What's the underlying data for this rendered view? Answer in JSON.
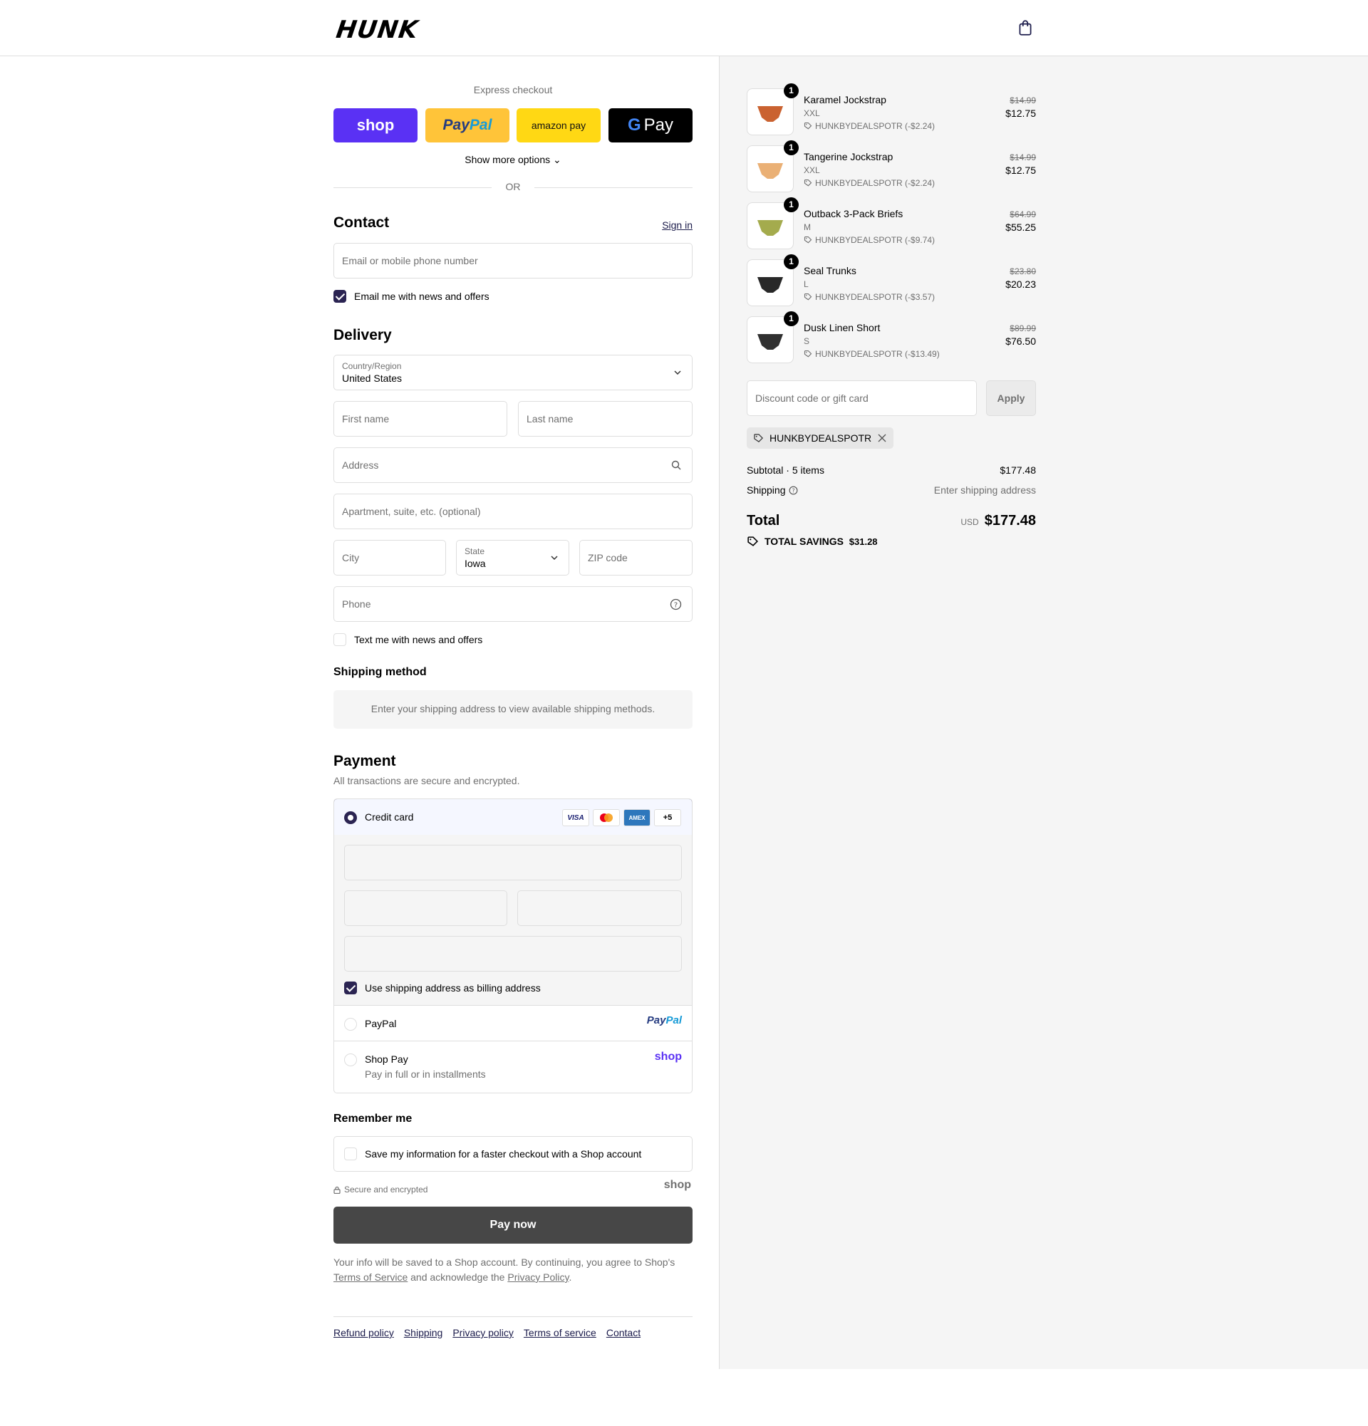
{
  "header": {
    "logo": "HUNK"
  },
  "express": {
    "title": "Express checkout",
    "shop": "shop",
    "paypal_a": "Pay",
    "paypal_b": "Pal",
    "amazon": "amazon pay",
    "gpay_g": "G",
    "gpay": "Pay",
    "more": "Show more options ⌄",
    "or": "OR"
  },
  "contact": {
    "heading": "Contact",
    "sign_in": "Sign in",
    "email_placeholder": "Email or mobile phone number",
    "news_label": "Email me with news and offers"
  },
  "delivery": {
    "heading": "Delivery",
    "country_label": "Country/Region",
    "country_value": "United States",
    "first_name": "First name",
    "last_name": "Last name",
    "address": "Address",
    "apartment": "Apartment, suite, etc. (optional)",
    "city": "City",
    "state_label": "State",
    "state_value": "Iowa",
    "zip": "ZIP code",
    "phone": "Phone",
    "text_label": "Text me with news and offers"
  },
  "shipping_method": {
    "heading": "Shipping method",
    "note": "Enter your shipping address to view available shipping methods."
  },
  "payment": {
    "heading": "Payment",
    "subtitle": "All transactions are secure and encrypted.",
    "credit_card": "Credit card",
    "visa": "VISA",
    "amex": "AMEX",
    "more_cards": "+5",
    "billing_label": "Use shipping address as billing address",
    "paypal": "PayPal",
    "paypal_logo_a": "Pay",
    "paypal_logo_b": "Pal",
    "shop_pay": "Shop Pay",
    "shop_pay_sub": "Pay in full or in installments",
    "shop_logo": "shop"
  },
  "remember": {
    "heading": "Remember me",
    "save_label": "Save my information for a faster checkout with a Shop account",
    "secure": "Secure and encrypted",
    "shop_logo": "shop"
  },
  "pay_now": "Pay now",
  "legal": {
    "line1": "Your info will be saved to a Shop account. By continuing, you agree to Shop's",
    "tos": "Terms of Service",
    "and": "and acknowledge the",
    "privacy": "Privacy Policy",
    "end": "."
  },
  "footer": [
    "Refund policy",
    "Shipping",
    "Privacy policy",
    "Terms of service",
    "Contact"
  ],
  "summary": {
    "items": [
      {
        "name": "Karamel Jockstrap",
        "variant": "XXL",
        "discount": "HUNKBYDEALSPOTR (-$2.24)",
        "old": "$14.99",
        "price": "$12.75",
        "qty": "1",
        "color": "#c4511a"
      },
      {
        "name": "Tangerine Jockstrap",
        "variant": "XXL",
        "discount": "HUNKBYDEALSPOTR (-$2.24)",
        "old": "$14.99",
        "price": "$12.75",
        "qty": "1",
        "color": "#e8a766"
      },
      {
        "name": "Outback 3-Pack Briefs",
        "variant": "M",
        "discount": "HUNKBYDEALSPOTR (-$9.74)",
        "old": "$64.99",
        "price": "$55.25",
        "qty": "1",
        "color": "#9aa23a"
      },
      {
        "name": "Seal Trunks",
        "variant": "L",
        "discount": "HUNKBYDEALSPOTR (-$3.57)",
        "old": "$23.80",
        "price": "$20.23",
        "qty": "1",
        "color": "#111111"
      },
      {
        "name": "Dusk Linen Short",
        "variant": "S",
        "discount": "HUNKBYDEALSPOTR (-$13.49)",
        "old": "$89.99",
        "price": "$76.50",
        "qty": "1",
        "color": "#1a1a1a"
      }
    ],
    "discount_placeholder": "Discount code or gift card",
    "apply": "Apply",
    "applied_code": "HUNKBYDEALSPOTR",
    "subtotal_label": "Subtotal · 5 items",
    "subtotal": "$177.48",
    "shipping_label": "Shipping",
    "shipping_value": "Enter shipping address",
    "total_label": "Total",
    "currency": "USD",
    "total": "$177.48",
    "savings_label": "TOTAL SAVINGS",
    "savings": "$31.28"
  },
  "colors": {
    "accent": "#2b2452",
    "shop": "#5a31f4",
    "paypal": "#ffc439",
    "amazon": "#ffd814"
  }
}
